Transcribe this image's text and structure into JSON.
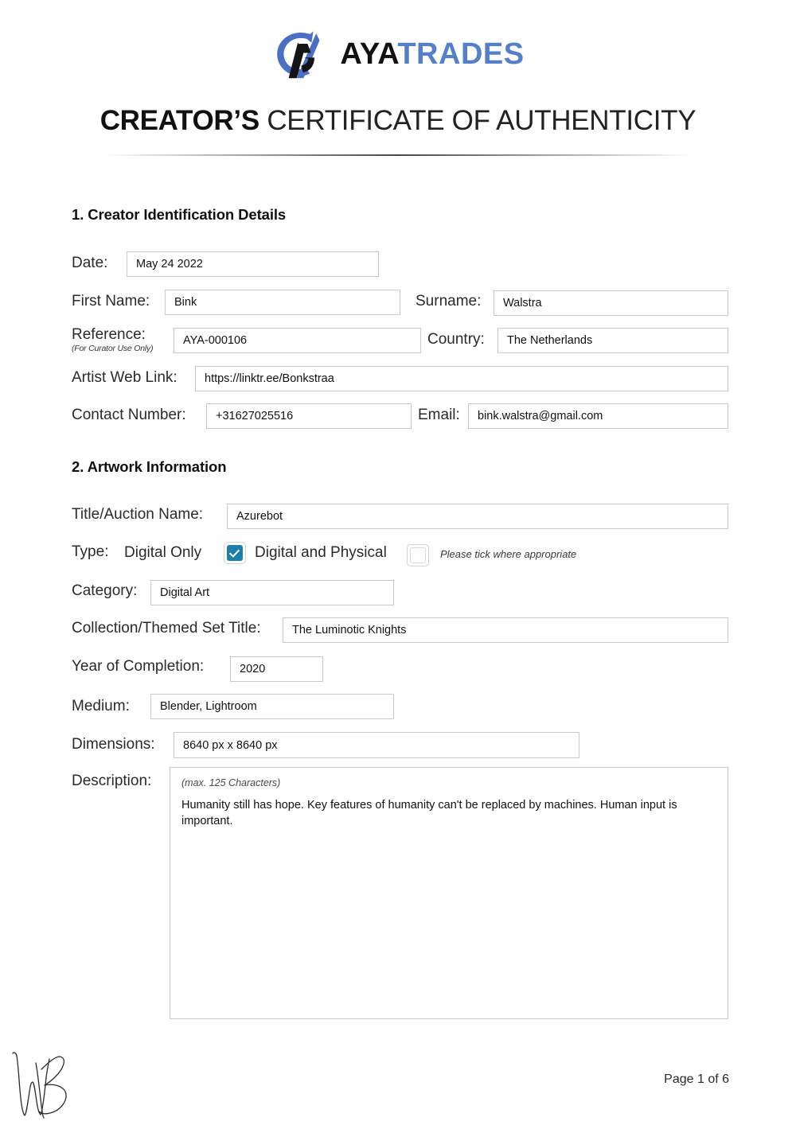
{
  "header": {
    "logo_icon": "ayatrades-swoosh-logo",
    "brand_first": "AYA",
    "brand_second": "TRADES",
    "title_strong": "CREATOR’S",
    "title_rest": "CERTIFICATE OF AUTHENTICITY",
    "brand_dark_color": "#111111",
    "brand_blue_color": "#5580c8"
  },
  "section1": {
    "title": "1. Creator Identification Details",
    "date_label": "Date:",
    "date_value": "May 24 2022",
    "first_name_label": "First Name:",
    "first_name_value": "Bink",
    "surname_label": "Surname:",
    "surname_value": "Walstra",
    "reference_label": "Reference:",
    "reference_sublabel": "(For Curator Use Only)",
    "reference_value": "AYA-000106",
    "country_label": "Country:",
    "country_value": "The Netherlands",
    "web_link_label": "Artist Web Link:",
    "web_link_value": "https://linktr.ee/Bonkstraa",
    "contact_label": "Contact Number:",
    "contact_value": "+31627025516",
    "email_label": "Email:",
    "email_value": "bink.walstra@gmail.com"
  },
  "section2": {
    "title": "2. Artwork Information",
    "title_name_label": "Title/Auction Name:",
    "title_name_value": "Azurebot",
    "type_label": "Type:",
    "type_option_1": "Digital Only",
    "type_option_1_checked": true,
    "type_option_2": "Digital and Physical",
    "type_option_2_checked": false,
    "tick_hint": "Please tick where appropriate",
    "checkbox_accent_color": "#1c7fa8",
    "category_label": "Category:",
    "category_value": "Digital Art",
    "collection_label": "Collection/Themed Set Title:",
    "collection_value": "The Luminotic Knights",
    "year_label": "Year of Completion:",
    "year_value": "2020",
    "medium_label": "Medium:",
    "medium_value": "Blender, Lightroom",
    "dimensions_label": "Dimensions:",
    "dimensions_value": "8640 px x 8640 px",
    "description_label": "Description:",
    "description_hint": "(max. 125 Characters)",
    "description_value": "Humanity still has hope. Key features of humanity can't be replaced by machines. Human input is important."
  },
  "footer": {
    "signature_icon": "handwritten-signature",
    "page_number": "Page 1 of 6"
  }
}
